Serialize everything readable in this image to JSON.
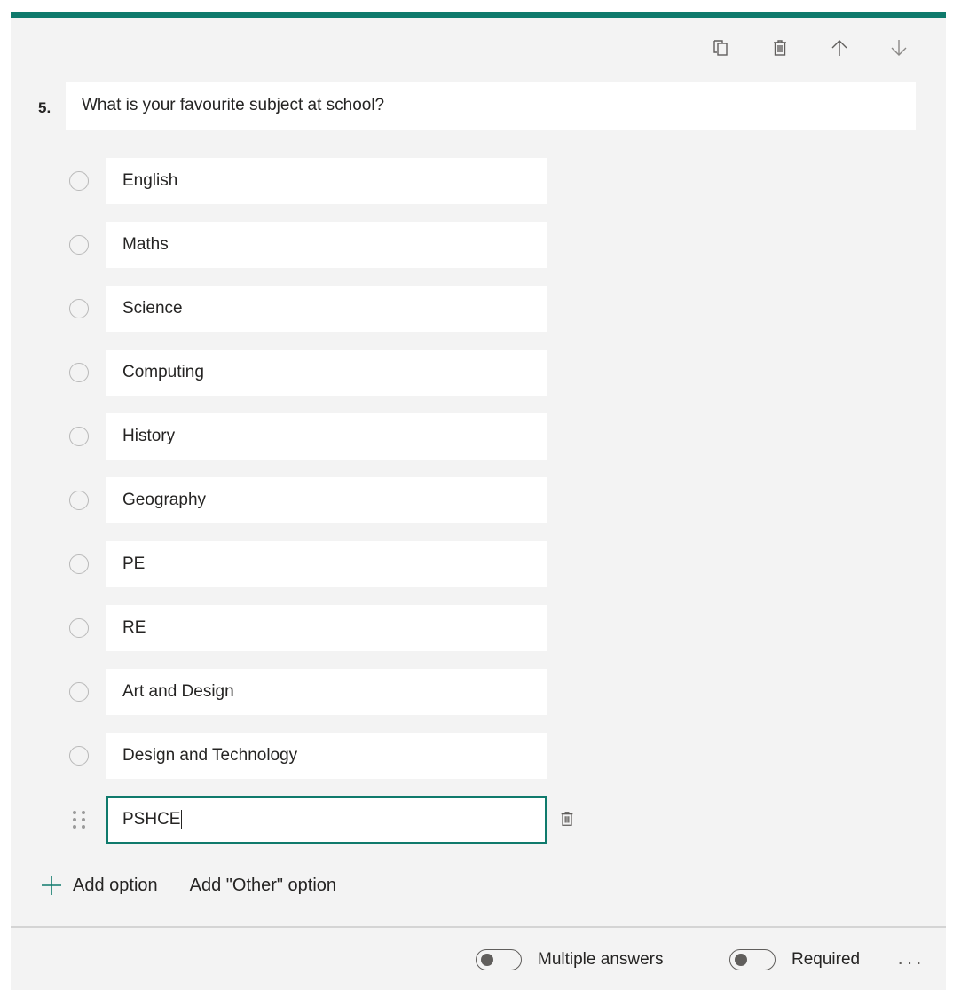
{
  "toolbar": {
    "copy_icon": "copy-icon",
    "delete_icon": "trash-icon",
    "move_up_icon": "arrow-up-icon",
    "move_down_icon": "arrow-down-icon"
  },
  "question": {
    "number": "5.",
    "title": "What is your favourite subject at school?"
  },
  "options": [
    {
      "label": "English"
    },
    {
      "label": "Maths"
    },
    {
      "label": "Science"
    },
    {
      "label": "Computing"
    },
    {
      "label": "History"
    },
    {
      "label": "Geography"
    },
    {
      "label": "PE"
    },
    {
      "label": "RE"
    },
    {
      "label": "Art and Design"
    },
    {
      "label": "Design and Technology"
    }
  ],
  "active_option": {
    "value": "PSHCE"
  },
  "actions": {
    "add_option": "Add option",
    "add_other_option": "Add \"Other\" option"
  },
  "footer": {
    "multiple_answers": "Multiple answers",
    "required": "Required",
    "more": "···"
  },
  "colors": {
    "accent": "#0f7a6c",
    "card_background": "#f3f3f3"
  }
}
